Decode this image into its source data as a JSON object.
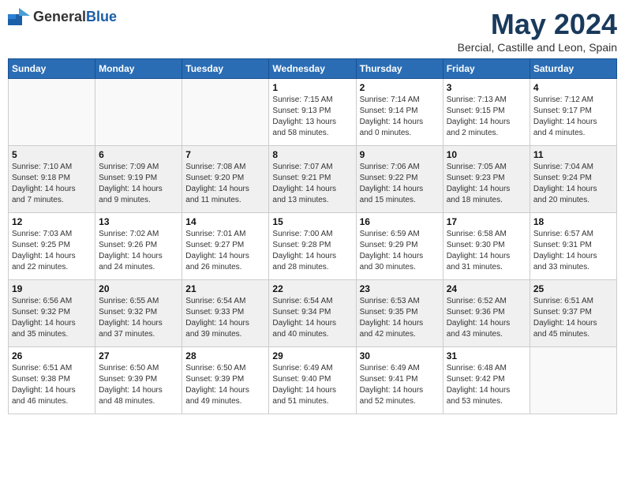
{
  "logo": {
    "general": "General",
    "blue": "Blue"
  },
  "title": "May 2024",
  "location": "Bercial, Castille and Leon, Spain",
  "weekdays": [
    "Sunday",
    "Monday",
    "Tuesday",
    "Wednesday",
    "Thursday",
    "Friday",
    "Saturday"
  ],
  "weeks": [
    [
      {
        "day": "",
        "info": ""
      },
      {
        "day": "",
        "info": ""
      },
      {
        "day": "",
        "info": ""
      },
      {
        "day": "1",
        "info": "Sunrise: 7:15 AM\nSunset: 9:13 PM\nDaylight: 13 hours\nand 58 minutes."
      },
      {
        "day": "2",
        "info": "Sunrise: 7:14 AM\nSunset: 9:14 PM\nDaylight: 14 hours\nand 0 minutes."
      },
      {
        "day": "3",
        "info": "Sunrise: 7:13 AM\nSunset: 9:15 PM\nDaylight: 14 hours\nand 2 minutes."
      },
      {
        "day": "4",
        "info": "Sunrise: 7:12 AM\nSunset: 9:17 PM\nDaylight: 14 hours\nand 4 minutes."
      }
    ],
    [
      {
        "day": "5",
        "info": "Sunrise: 7:10 AM\nSunset: 9:18 PM\nDaylight: 14 hours\nand 7 minutes."
      },
      {
        "day": "6",
        "info": "Sunrise: 7:09 AM\nSunset: 9:19 PM\nDaylight: 14 hours\nand 9 minutes."
      },
      {
        "day": "7",
        "info": "Sunrise: 7:08 AM\nSunset: 9:20 PM\nDaylight: 14 hours\nand 11 minutes."
      },
      {
        "day": "8",
        "info": "Sunrise: 7:07 AM\nSunset: 9:21 PM\nDaylight: 14 hours\nand 13 minutes."
      },
      {
        "day": "9",
        "info": "Sunrise: 7:06 AM\nSunset: 9:22 PM\nDaylight: 14 hours\nand 15 minutes."
      },
      {
        "day": "10",
        "info": "Sunrise: 7:05 AM\nSunset: 9:23 PM\nDaylight: 14 hours\nand 18 minutes."
      },
      {
        "day": "11",
        "info": "Sunrise: 7:04 AM\nSunset: 9:24 PM\nDaylight: 14 hours\nand 20 minutes."
      }
    ],
    [
      {
        "day": "12",
        "info": "Sunrise: 7:03 AM\nSunset: 9:25 PM\nDaylight: 14 hours\nand 22 minutes."
      },
      {
        "day": "13",
        "info": "Sunrise: 7:02 AM\nSunset: 9:26 PM\nDaylight: 14 hours\nand 24 minutes."
      },
      {
        "day": "14",
        "info": "Sunrise: 7:01 AM\nSunset: 9:27 PM\nDaylight: 14 hours\nand 26 minutes."
      },
      {
        "day": "15",
        "info": "Sunrise: 7:00 AM\nSunset: 9:28 PM\nDaylight: 14 hours\nand 28 minutes."
      },
      {
        "day": "16",
        "info": "Sunrise: 6:59 AM\nSunset: 9:29 PM\nDaylight: 14 hours\nand 30 minutes."
      },
      {
        "day": "17",
        "info": "Sunrise: 6:58 AM\nSunset: 9:30 PM\nDaylight: 14 hours\nand 31 minutes."
      },
      {
        "day": "18",
        "info": "Sunrise: 6:57 AM\nSunset: 9:31 PM\nDaylight: 14 hours\nand 33 minutes."
      }
    ],
    [
      {
        "day": "19",
        "info": "Sunrise: 6:56 AM\nSunset: 9:32 PM\nDaylight: 14 hours\nand 35 minutes."
      },
      {
        "day": "20",
        "info": "Sunrise: 6:55 AM\nSunset: 9:32 PM\nDaylight: 14 hours\nand 37 minutes."
      },
      {
        "day": "21",
        "info": "Sunrise: 6:54 AM\nSunset: 9:33 PM\nDaylight: 14 hours\nand 39 minutes."
      },
      {
        "day": "22",
        "info": "Sunrise: 6:54 AM\nSunset: 9:34 PM\nDaylight: 14 hours\nand 40 minutes."
      },
      {
        "day": "23",
        "info": "Sunrise: 6:53 AM\nSunset: 9:35 PM\nDaylight: 14 hours\nand 42 minutes."
      },
      {
        "day": "24",
        "info": "Sunrise: 6:52 AM\nSunset: 9:36 PM\nDaylight: 14 hours\nand 43 minutes."
      },
      {
        "day": "25",
        "info": "Sunrise: 6:51 AM\nSunset: 9:37 PM\nDaylight: 14 hours\nand 45 minutes."
      }
    ],
    [
      {
        "day": "26",
        "info": "Sunrise: 6:51 AM\nSunset: 9:38 PM\nDaylight: 14 hours\nand 46 minutes."
      },
      {
        "day": "27",
        "info": "Sunrise: 6:50 AM\nSunset: 9:39 PM\nDaylight: 14 hours\nand 48 minutes."
      },
      {
        "day": "28",
        "info": "Sunrise: 6:50 AM\nSunset: 9:39 PM\nDaylight: 14 hours\nand 49 minutes."
      },
      {
        "day": "29",
        "info": "Sunrise: 6:49 AM\nSunset: 9:40 PM\nDaylight: 14 hours\nand 51 minutes."
      },
      {
        "day": "30",
        "info": "Sunrise: 6:49 AM\nSunset: 9:41 PM\nDaylight: 14 hours\nand 52 minutes."
      },
      {
        "day": "31",
        "info": "Sunrise: 6:48 AM\nSunset: 9:42 PM\nDaylight: 14 hours\nand 53 minutes."
      },
      {
        "day": "",
        "info": ""
      }
    ]
  ]
}
